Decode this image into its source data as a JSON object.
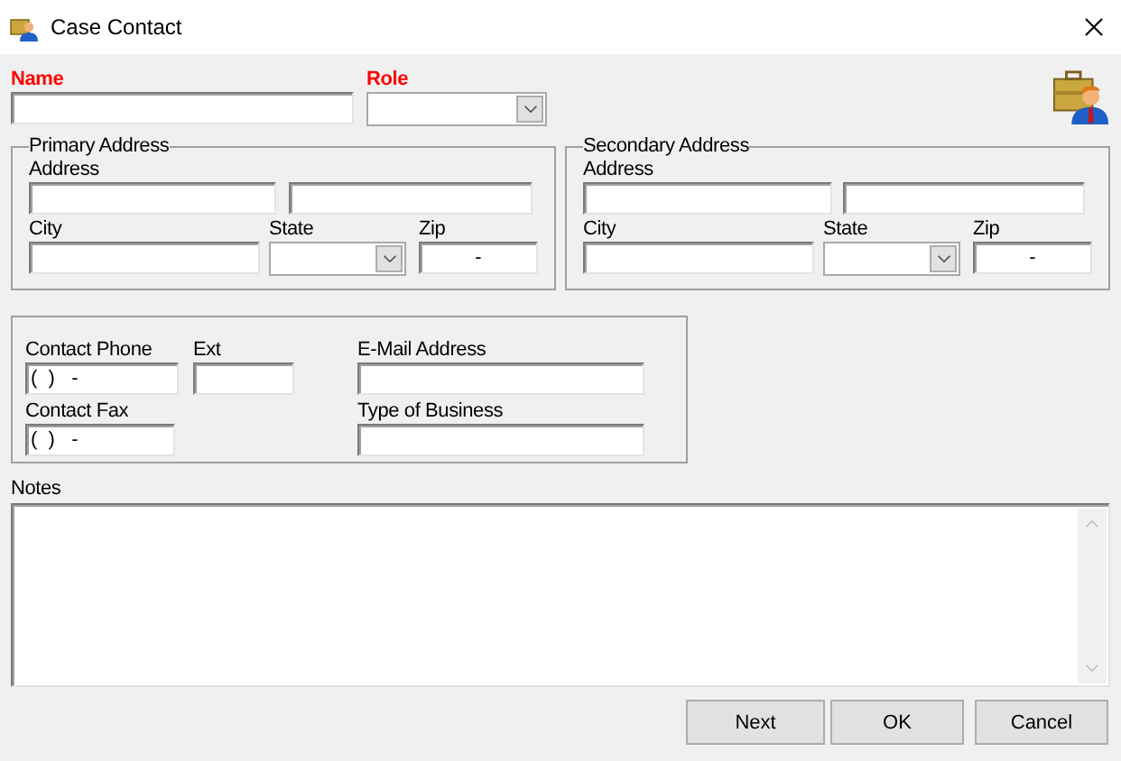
{
  "window": {
    "title": "Case Contact"
  },
  "name": {
    "label": "Name",
    "required": true
  },
  "role": {
    "label": "Role",
    "required": true
  },
  "primary_address": {
    "legend": "Primary Address",
    "address_label": "Address",
    "city_label": "City",
    "state_label": "State",
    "zip_label": "Zip",
    "zip_value": "-"
  },
  "secondary_address": {
    "legend": "Secondary Address",
    "address_label": "Address",
    "city_label": "City",
    "state_label": "State",
    "zip_label": "Zip",
    "zip_value": "-"
  },
  "contact": {
    "phone_label": "Contact Phone",
    "phone_value": "(  )   -",
    "ext_label": "Ext",
    "email_label": "E-Mail Address",
    "fax_label": "Contact Fax",
    "fax_value": "(  )   -",
    "business_label": "Type of Business"
  },
  "notes": {
    "label": "Notes"
  },
  "buttons": [
    {
      "label": "Next"
    },
    {
      "label": "OK"
    },
    {
      "label": "Cancel"
    }
  ]
}
